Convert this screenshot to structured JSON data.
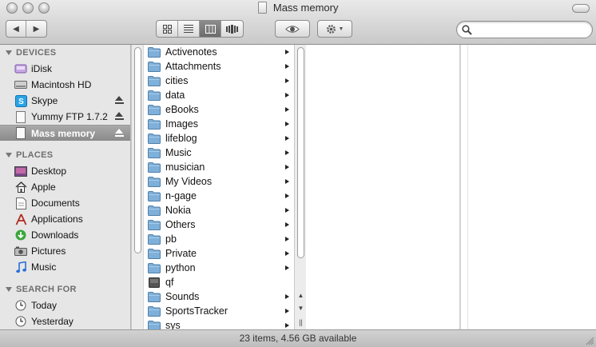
{
  "window": {
    "title": "Mass memory"
  },
  "toolbar": {
    "search_placeholder": ""
  },
  "sidebar": {
    "devices_label": "DEVICES",
    "devices": [
      {
        "label": "iDisk",
        "icon": "idisk-icon",
        "eject": false
      },
      {
        "label": "Macintosh HD",
        "icon": "harddisk-icon",
        "eject": false
      },
      {
        "label": "Skype",
        "icon": "skype-icon",
        "eject": true
      },
      {
        "label": "Yummy FTP 1.7.2",
        "icon": "disk-image-icon",
        "eject": true
      },
      {
        "label": "Mass memory",
        "icon": "removable-drive-icon",
        "eject": true,
        "selected": true
      }
    ],
    "places_label": "PLACES",
    "places": [
      {
        "label": "Desktop",
        "icon": "desktop-icon"
      },
      {
        "label": "Apple",
        "icon": "home-icon"
      },
      {
        "label": "Documents",
        "icon": "documents-icon"
      },
      {
        "label": "Applications",
        "icon": "applications-icon"
      },
      {
        "label": "Downloads",
        "icon": "downloads-icon"
      },
      {
        "label": "Pictures",
        "icon": "pictures-icon"
      },
      {
        "label": "Music",
        "icon": "music-icon"
      }
    ],
    "search_label": "SEARCH FOR",
    "search_items": [
      {
        "label": "Today",
        "icon": "clock-icon"
      },
      {
        "label": "Yesterday",
        "icon": "clock-icon"
      }
    ]
  },
  "column1": {
    "items": [
      {
        "name": "Activenotes",
        "kind": "folder"
      },
      {
        "name": "Attachments",
        "kind": "folder"
      },
      {
        "name": "cities",
        "kind": "folder"
      },
      {
        "name": "data",
        "kind": "folder"
      },
      {
        "name": "eBooks",
        "kind": "folder"
      },
      {
        "name": "Images",
        "kind": "folder"
      },
      {
        "name": "lifeblog",
        "kind": "folder"
      },
      {
        "name": "Music",
        "kind": "folder"
      },
      {
        "name": "musician",
        "kind": "folder"
      },
      {
        "name": "My Videos",
        "kind": "folder"
      },
      {
        "name": "n-gage",
        "kind": "folder"
      },
      {
        "name": "Nokia",
        "kind": "folder"
      },
      {
        "name": "Others",
        "kind": "folder"
      },
      {
        "name": "pb",
        "kind": "folder"
      },
      {
        "name": "Private",
        "kind": "folder"
      },
      {
        "name": "python",
        "kind": "folder"
      },
      {
        "name": "qf",
        "kind": "file"
      },
      {
        "name": "Sounds",
        "kind": "folder"
      },
      {
        "name": "SportsTracker",
        "kind": "folder"
      },
      {
        "name": "sys",
        "kind": "folder"
      }
    ]
  },
  "status": {
    "text": "23 items, 4.56 GB available"
  },
  "colors": {
    "folder": "#7fb0d9",
    "selection": "#8e8e8e",
    "chrome": "#d6d6d6"
  }
}
